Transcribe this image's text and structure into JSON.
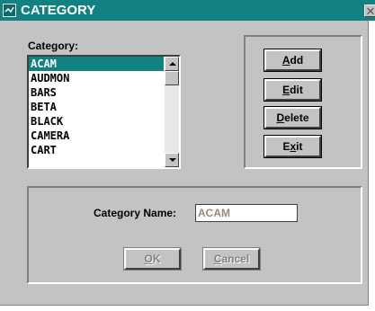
{
  "window": {
    "title": "CATEGORY",
    "close_glyph": "✕"
  },
  "list": {
    "label": "Category:",
    "items": [
      "ACAM",
      "AUDMON",
      "BARS",
      "BETA",
      "BLACK",
      "CAMERA",
      "CART"
    ],
    "selected": "ACAM"
  },
  "buttons": {
    "add": {
      "pre": "",
      "accel": "A",
      "post": "dd"
    },
    "edit": {
      "pre": "",
      "accel": "E",
      "post": "dit"
    },
    "delete": {
      "pre": "",
      "accel": "D",
      "post": "elete"
    },
    "exit": {
      "pre": "E",
      "accel": "x",
      "post": "it"
    }
  },
  "form": {
    "name_label": "Category Name:",
    "name_value": "ACAM",
    "ok": {
      "pre": "",
      "accel": "O",
      "post": "K"
    },
    "cancel": {
      "pre": "",
      "accel": "C",
      "post": "ancel"
    }
  },
  "colors": {
    "titlebar": "#128181",
    "face": "#c3c3c3",
    "selection": "#128181"
  }
}
